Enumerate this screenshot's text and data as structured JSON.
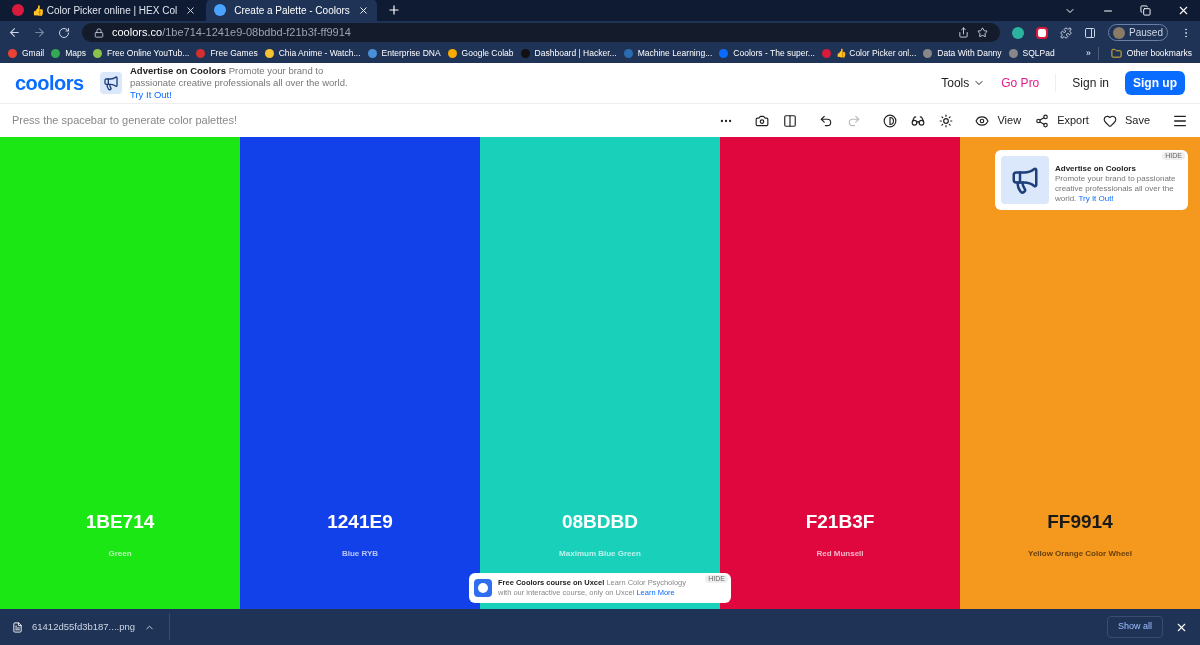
{
  "browser": {
    "tabs": [
      {
        "title": "👍 Color Picker online | HEX Col",
        "selected": false
      },
      {
        "title": "Create a Palette - Coolors",
        "selected": true
      }
    ],
    "url_host": "coolors.co",
    "url_path": "/1be714-1241e9-08bdbd-f21b3f-ff9914",
    "profile": "Paused",
    "bookmarks": [
      {
        "label": "Gmail",
        "color": "#ea4335"
      },
      {
        "label": "Maps",
        "color": "#34a853"
      },
      {
        "label": "Free Online YouTub...",
        "color": "#8bc34a"
      },
      {
        "label": "Free Games",
        "color": "#d32f2f"
      },
      {
        "label": "Chia Anime - Watch...",
        "color": "#f4c430"
      },
      {
        "label": "Enterprise DNA",
        "color": "#4a90d9"
      },
      {
        "label": "Google Colab",
        "color": "#f9ab00"
      },
      {
        "label": "Dashboard | Hacker...",
        "color": "#111111"
      },
      {
        "label": "Machine Learning...",
        "color": "#2b6cb0"
      },
      {
        "label": "Coolors - The super...",
        "color": "#0a6cff"
      },
      {
        "label": "👍 Color Picker onl...",
        "color": "#d81b3c"
      },
      {
        "label": "Data With Danny",
        "color": "#888888"
      },
      {
        "label": "SQLPad",
        "color": "#888888"
      }
    ],
    "overflow": "»",
    "other_bookmarks": "Other bookmarks"
  },
  "header": {
    "logo": "coolors",
    "ad_title": "Advertise on Coolors",
    "ad_text": "Promote your brand to passionate creative professionals all over the world.",
    "ad_link": "Try It Out!",
    "tools": "Tools",
    "go_pro": "Go Pro",
    "sign_in": "Sign in",
    "sign_up": "Sign up"
  },
  "toolbar": {
    "hint": "Press the spacebar to generate color palettes!",
    "view": "View",
    "export": "Export",
    "save": "Save"
  },
  "swatches": [
    {
      "hex": "1BE714",
      "name": "Green",
      "color": "#1be714",
      "kind": "light"
    },
    {
      "hex": "1241E9",
      "name": "Blue RYB",
      "color": "#1241e9",
      "kind": "light"
    },
    {
      "hex": "08BDBD",
      "name": "Maximum Blue Green",
      "color": "#19d1bb",
      "kind": "light"
    },
    {
      "hex": "F21B3F",
      "name": "Red Munsell",
      "color": "#e0073f",
      "kind": "light"
    },
    {
      "hex": "FF9914",
      "name": "Yellow Orange Color Wheel",
      "color": "#f4981e",
      "kind": "dark"
    }
  ],
  "side_ad": {
    "hide": "HIDE",
    "title": "Advertise on Coolors",
    "text": "Promote your brand to passionate creative professionals all over the",
    "link_prefix": "world.",
    "link": "Try It Out!"
  },
  "bottom_ad": {
    "hide": "HIDE",
    "title": "Free Coolors course on Uxcel",
    "text": "Learn Color Psychology with our interactive course, only on Uxcel",
    "link": "Learn More"
  },
  "downloads": {
    "file": "61412d55fd3b187....png",
    "show_all": "Show all"
  }
}
